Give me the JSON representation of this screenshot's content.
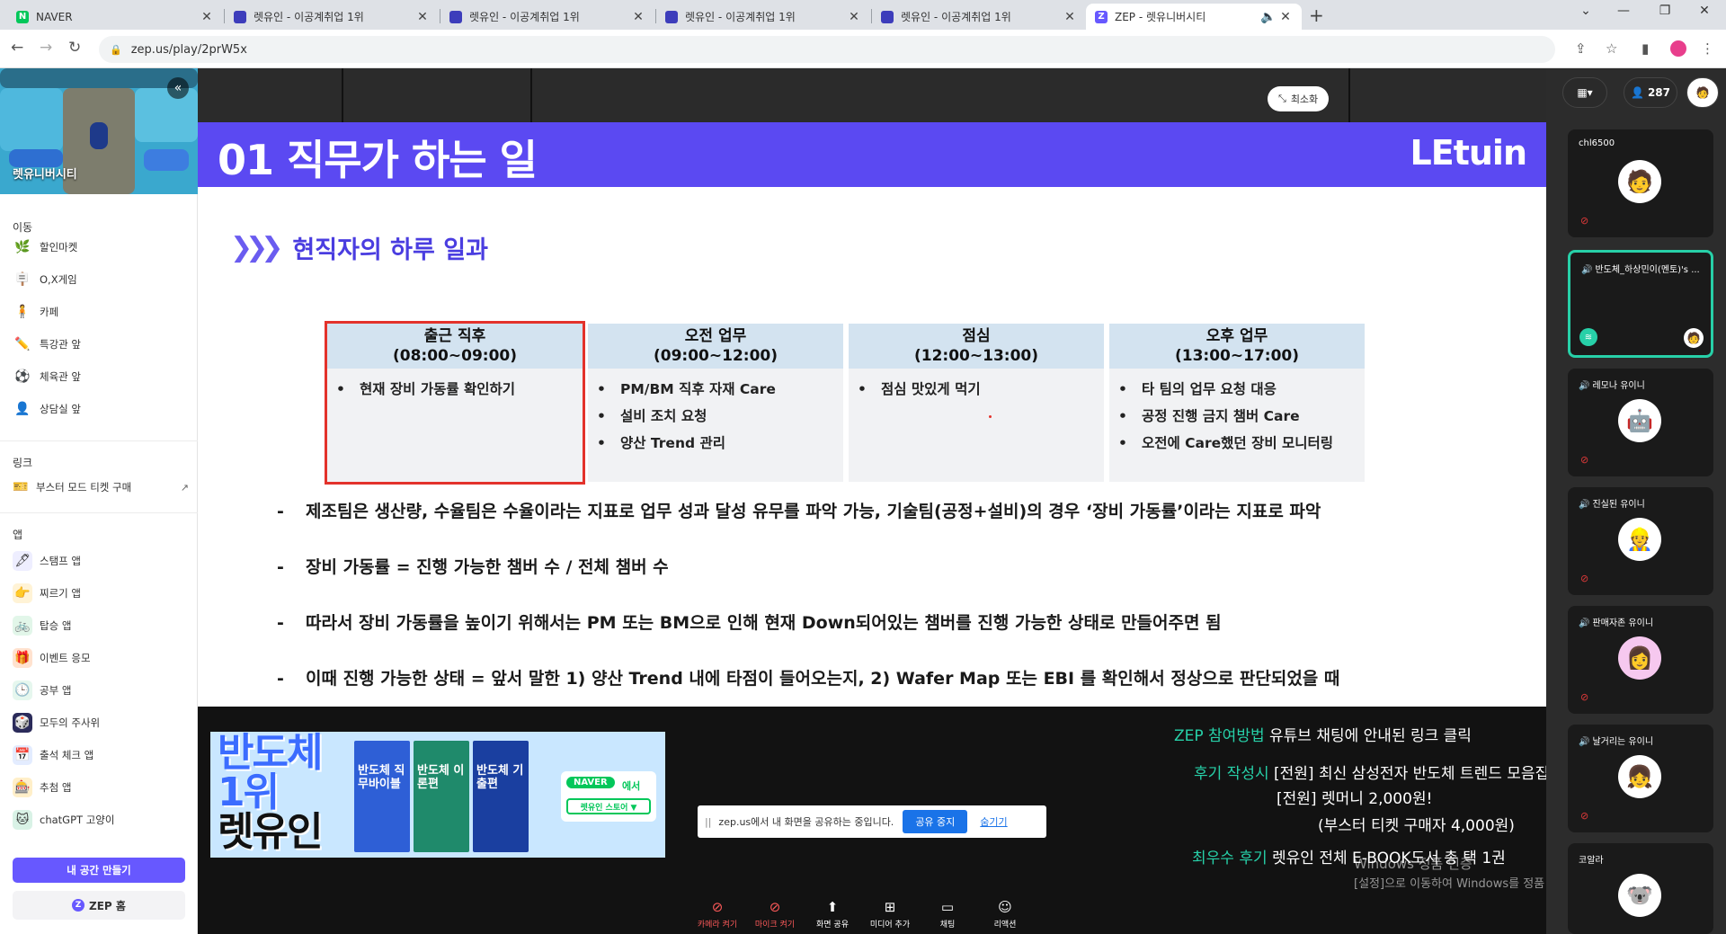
{
  "browser": {
    "tabs": [
      {
        "title": "NAVER",
        "favicon_color": "#03c75a",
        "favicon_letter": "N"
      },
      {
        "title": "렛유인 - 이공계취업 1위",
        "favicon_color": "#3d3dbb",
        "favicon_letter": ""
      },
      {
        "title": "렛유인 - 이공계취업 1위",
        "favicon_color": "#3d3dbb",
        "favicon_letter": ""
      },
      {
        "title": "렛유인 - 이공계취업 1위",
        "favicon_color": "#3d3dbb",
        "favicon_letter": ""
      },
      {
        "title": "렛유인 - 이공계취업 1위",
        "favicon_color": "#3d3dbb",
        "favicon_letter": ""
      },
      {
        "title": "ZEP - 렛유니버시티",
        "favicon_color": "#6758ff",
        "favicon_letter": "Z"
      }
    ],
    "url": "zep.us/play/2prW5x"
  },
  "sidebar": {
    "map_name": "렛유니버시티",
    "sections": [
      {
        "title": "이동",
        "items": [
          "할인마켓",
          "O,X게임",
          "카페",
          "특강관 앞",
          "체육관 앞",
          "상담실 앞"
        ]
      },
      {
        "title": "링크",
        "items": [
          "부스터 모드 티켓 구매"
        ]
      },
      {
        "title": "앱",
        "items": [
          "스탬프 앱",
          "찌르기 앱",
          "탑승 앱",
          "이벤트 응모",
          "공부 앱",
          "모두의 주사위",
          "출석 체크 앱",
          "추첨 앱",
          "chatGPT 고양이"
        ]
      }
    ],
    "create_space": "내 공간 만들기",
    "zep_home": "ZEP 홈"
  },
  "stage": {
    "minimize_label": "최소화",
    "participant_count": "287"
  },
  "slide": {
    "title": "01 직무가 하는 일",
    "logo": "LEtuin",
    "subheading": "현직자의 하루 일과",
    "schedule": [
      {
        "name": "출근 직후",
        "time": "(08:00~09:00)",
        "items": [
          "현재 장비 가동률 확인하기"
        ]
      },
      {
        "name": "오전 업무",
        "time": "(09:00~12:00)",
        "items": [
          "PM/BM 직후 자재 Care",
          "설비 조치 요청",
          "양산 Trend 관리"
        ]
      },
      {
        "name": "점심",
        "time": "(12:00~13:00)",
        "items": [
          "점심 맛있게 먹기"
        ]
      },
      {
        "name": "오후 업무",
        "time": "(13:00~17:00)",
        "items": [
          "타 팀의 업무 요청 대응",
          "공정 진행 금지 챔버 Care",
          "오전에 Care했던 장비 모니터링"
        ]
      }
    ],
    "bullets": [
      "제조팀은 생산량, 수율팀은 수율이라는 지표로 업무 성과 달성 유무를 파악 가능, 기술팀(공정+설비)의 경우 ‘장비 가동률’이라는 지표로 파악",
      "장비 가동률 = 진행 가능한 챔버 수 / 전체 챔버 수",
      "따라서 장비 가동률을 높이기 위해서는 PM 또는 BM으로 인해 현재 Down되어있는 챔버를 진행 가능한 상태로 만들어주면 됨",
      "이때 진행 가능한 상태 = 앞서 말한 1) 양산 Trend 내에 타점이 들어오는지, 2) Wafer Map 또는 EBI 를 확인해서 정상으로 판단되었을 때"
    ]
  },
  "banner": {
    "line1": "반도체",
    "line2": "1위",
    "line3": "렛유인",
    "books": [
      "반도체 직무바이블",
      "반도체 이론편",
      "반도체 기출편"
    ],
    "naver": "NAVER",
    "naver_suffix": "에서",
    "store": "렛유인 스토어 ▼"
  },
  "info": {
    "line1_green": "ZEP 참여방법",
    "line1_white": "유튜브 채팅에 안내된 링크 클릭",
    "line2_green": "후기 작성시",
    "line2_white": "[전원] 최신 삼성전자 반도체 트렌드 모음집",
    "line3_white": "[전원] 렛머니 2,000원!",
    "line4_white": "(부스터 티켓 구매자 4,000원)",
    "line5_green": "최우수 후기",
    "line5_white": "렛유인 전체 E-BOOK도서 총 택 1권"
  },
  "watermark": {
    "line1": "Windows 정품 인증",
    "line2": "[설정]으로 이동하여 Windows를 정품 인증합니다."
  },
  "share_notice": {
    "text": "zep.us에서 내 화면을 공유하는 중입니다.",
    "stop": "공유 중지",
    "hide": "숨기기"
  },
  "controls": [
    {
      "label": "카메라 켜기",
      "icon": "camera-off-icon",
      "off": true
    },
    {
      "label": "마이크 켜기",
      "icon": "mic-off-icon",
      "off": true
    },
    {
      "label": "화면 공유",
      "icon": "screen-share-icon",
      "off": false
    },
    {
      "label": "미디어 추가",
      "icon": "media-add-icon",
      "off": false
    },
    {
      "label": "채팅",
      "icon": "chat-icon",
      "off": false
    },
    {
      "label": "리액션",
      "icon": "reaction-icon",
      "off": false
    }
  ],
  "participants": [
    {
      "name": "chl6500",
      "speaking": false,
      "mic": false,
      "muted": true
    },
    {
      "name": "반도체_하상민이(멘토)'s ...",
      "speaking": true,
      "mic": true,
      "muted": false
    },
    {
      "name": "레모나 유이니",
      "speaking": false,
      "mic": true,
      "muted": true
    },
    {
      "name": "진실된 유이니",
      "speaking": false,
      "mic": true,
      "muted": true
    },
    {
      "name": "판매자존 유이니",
      "speaking": false,
      "mic": true,
      "muted": true
    },
    {
      "name": "날거리는 유이니",
      "speaking": false,
      "mic": true,
      "muted": true
    },
    {
      "name": "코알라",
      "speaking": false,
      "mic": false,
      "muted": false
    }
  ]
}
